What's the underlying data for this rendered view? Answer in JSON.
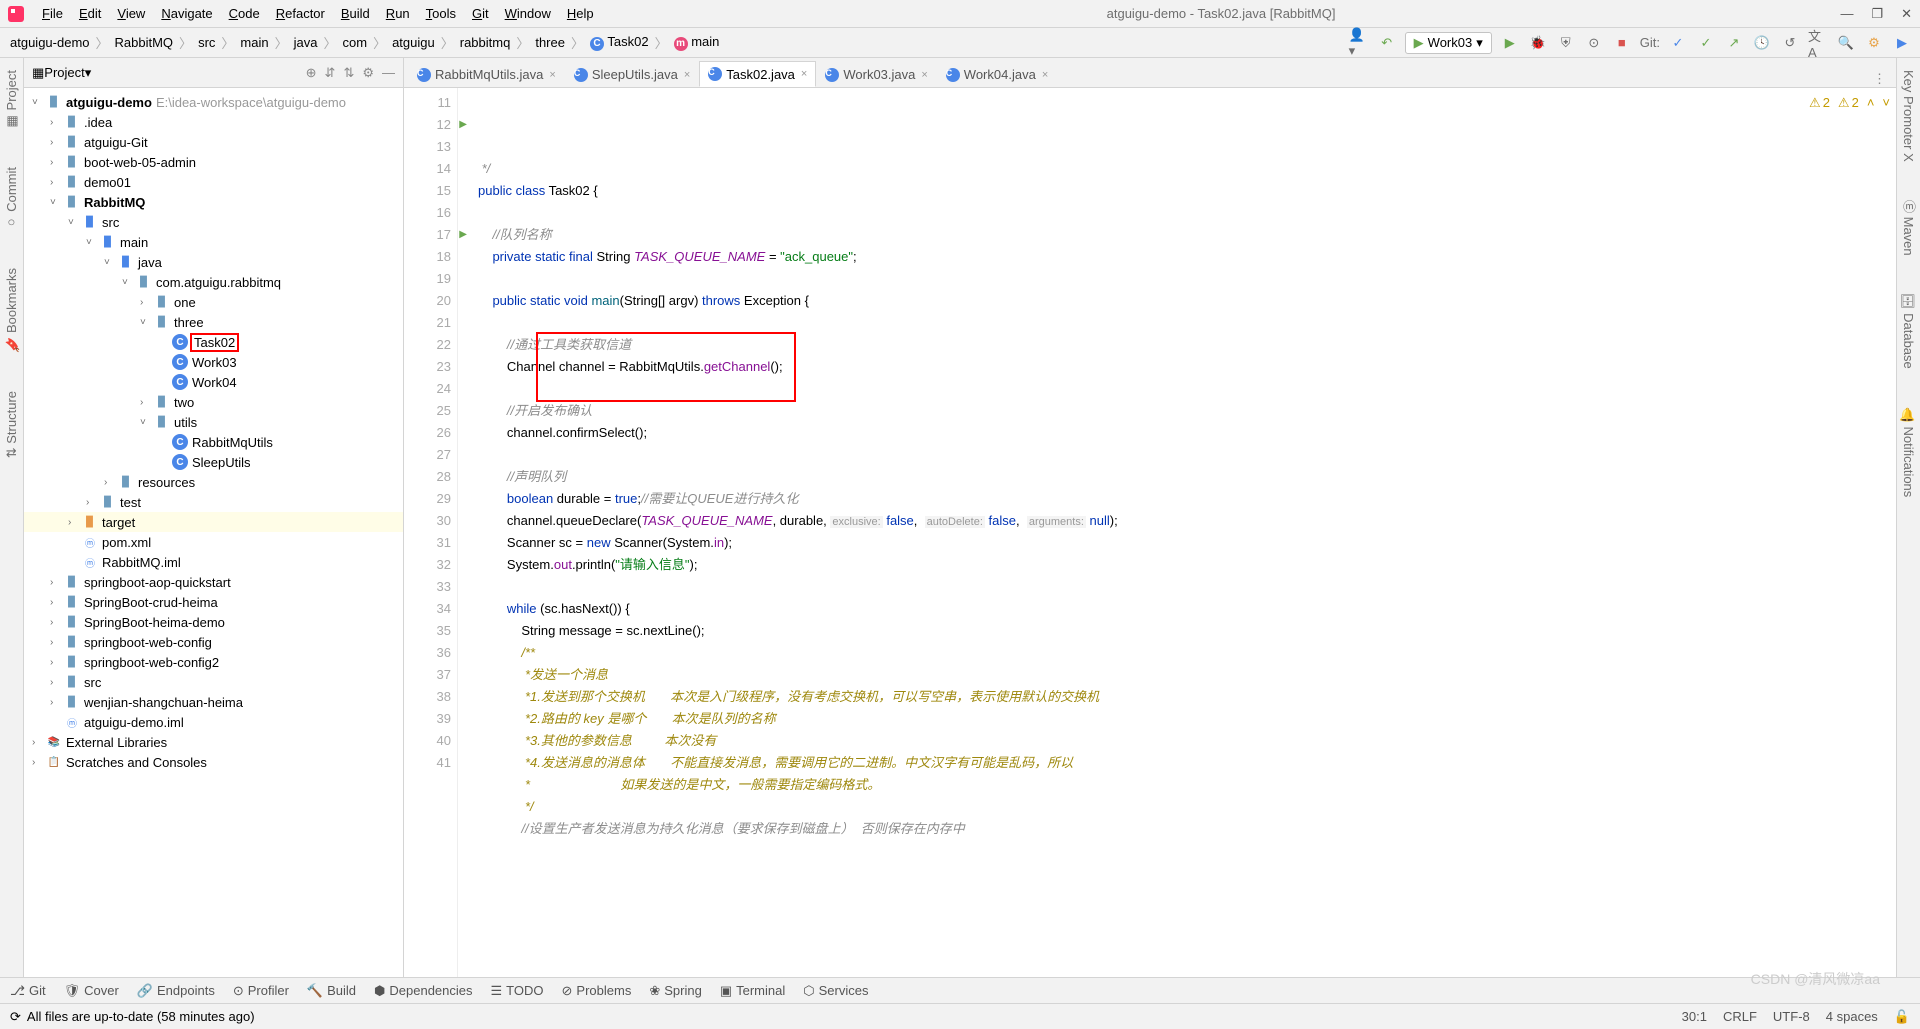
{
  "window": {
    "title": "atguigu-demo - Task02.java [RabbitMQ]"
  },
  "menus": [
    "File",
    "Edit",
    "View",
    "Navigate",
    "Code",
    "Refactor",
    "Build",
    "Run",
    "Tools",
    "Git",
    "Window",
    "Help"
  ],
  "breadcrumb": {
    "parts": [
      "atguigu-demo",
      "RabbitMQ",
      "src",
      "main",
      "java",
      "com",
      "atguigu",
      "rabbitmq",
      "three"
    ],
    "class": "Task02",
    "method": "main"
  },
  "run_config": "Work03",
  "git_label": "Git:",
  "project_panel": {
    "title": "Project",
    "root": {
      "name": "atguigu-demo",
      "path": "E:\\idea-workspace\\atguigu-demo"
    },
    "nodes": [
      {
        "indent": 1,
        "arrow": ">",
        "icon": "folder",
        "name": ".idea"
      },
      {
        "indent": 1,
        "arrow": ">",
        "icon": "folder",
        "name": "atguigu-Git"
      },
      {
        "indent": 1,
        "arrow": ">",
        "icon": "folder",
        "name": "boot-web-05-admin"
      },
      {
        "indent": 1,
        "arrow": ">",
        "icon": "folder",
        "name": "demo01"
      },
      {
        "indent": 1,
        "arrow": "v",
        "icon": "folder",
        "name": "RabbitMQ",
        "bold": true
      },
      {
        "indent": 2,
        "arrow": "v",
        "icon": "folder-blue",
        "name": "src"
      },
      {
        "indent": 3,
        "arrow": "v",
        "icon": "folder-blue",
        "name": "main"
      },
      {
        "indent": 4,
        "arrow": "v",
        "icon": "folder-blue",
        "name": "java"
      },
      {
        "indent": 5,
        "arrow": "v",
        "icon": "folder",
        "name": "com.atguigu.rabbitmq"
      },
      {
        "indent": 6,
        "arrow": ">",
        "icon": "folder",
        "name": "one"
      },
      {
        "indent": 6,
        "arrow": "v",
        "icon": "folder",
        "name": "three"
      },
      {
        "indent": 7,
        "arrow": "",
        "icon": "class",
        "name": "Task02",
        "selected": true
      },
      {
        "indent": 7,
        "arrow": "",
        "icon": "class",
        "name": "Work03"
      },
      {
        "indent": 7,
        "arrow": "",
        "icon": "class",
        "name": "Work04"
      },
      {
        "indent": 6,
        "arrow": ">",
        "icon": "folder",
        "name": "two"
      },
      {
        "indent": 6,
        "arrow": "v",
        "icon": "folder",
        "name": "utils"
      },
      {
        "indent": 7,
        "arrow": "",
        "icon": "class",
        "name": "RabbitMqUtils"
      },
      {
        "indent": 7,
        "arrow": "",
        "icon": "class",
        "name": "SleepUtils"
      },
      {
        "indent": 4,
        "arrow": ">",
        "icon": "folder",
        "name": "resources"
      },
      {
        "indent": 3,
        "arrow": ">",
        "icon": "folder",
        "name": "test"
      },
      {
        "indent": 2,
        "arrow": ">",
        "icon": "folder-orange",
        "name": "target",
        "highlighted": true
      },
      {
        "indent": 2,
        "arrow": "",
        "icon": "module",
        "name": "pom.xml"
      },
      {
        "indent": 2,
        "arrow": "",
        "icon": "module",
        "name": "RabbitMQ.iml"
      },
      {
        "indent": 1,
        "arrow": ">",
        "icon": "folder",
        "name": "springboot-aop-quickstart"
      },
      {
        "indent": 1,
        "arrow": ">",
        "icon": "folder",
        "name": "SpringBoot-crud-heima"
      },
      {
        "indent": 1,
        "arrow": ">",
        "icon": "folder",
        "name": "SpringBoot-heima-demo"
      },
      {
        "indent": 1,
        "arrow": ">",
        "icon": "folder",
        "name": "springboot-web-config"
      },
      {
        "indent": 1,
        "arrow": ">",
        "icon": "folder",
        "name": "springboot-web-config2"
      },
      {
        "indent": 1,
        "arrow": ">",
        "icon": "folder",
        "name": "src"
      },
      {
        "indent": 1,
        "arrow": ">",
        "icon": "folder",
        "name": "wenjian-shangchuan-heima"
      },
      {
        "indent": 1,
        "arrow": "",
        "icon": "module",
        "name": "atguigu-demo.iml"
      },
      {
        "indent": 0,
        "arrow": ">",
        "icon": "lib",
        "name": "External Libraries"
      },
      {
        "indent": 0,
        "arrow": ">",
        "icon": "scratch",
        "name": "Scratches and Consoles"
      }
    ]
  },
  "tabs": [
    {
      "name": "RabbitMqUtils.java",
      "active": false
    },
    {
      "name": "SleepUtils.java",
      "active": false
    },
    {
      "name": "Task02.java",
      "active": true
    },
    {
      "name": "Work03.java",
      "active": false
    },
    {
      "name": "Work04.java",
      "active": false
    }
  ],
  "warnings": {
    "count1": "2",
    "count2": "2"
  },
  "code_lines": [
    {
      "n": 11,
      "html": "<span class='com'> */</span>"
    },
    {
      "n": 12,
      "run": true,
      "html": "<span class='kw'>public class</span> Task02 {"
    },
    {
      "n": 13,
      "html": ""
    },
    {
      "n": 14,
      "html": "    <span class='com'>//队列名称</span>"
    },
    {
      "n": 15,
      "html": "    <span class='kw'>private static final</span> String <span class='const'>TASK_QUEUE_NAME</span> = <span class='str'>\"ack_queue\"</span>;"
    },
    {
      "n": 16,
      "html": ""
    },
    {
      "n": 17,
      "run": true,
      "html": "    <span class='kw'>public static void</span> <span class='method'>main</span>(String[] argv) <span class='kw'>throws</span> Exception {"
    },
    {
      "n": 18,
      "html": ""
    },
    {
      "n": 19,
      "html": "        <span class='com'>//通过工具类获取信道</span>"
    },
    {
      "n": 20,
      "html": "        Channel channel = RabbitMqUtils.<span class='field'>getChannel</span>();"
    },
    {
      "n": 21,
      "html": ""
    },
    {
      "n": 22,
      "html": "        <span class='com'>//开启发布确认</span>"
    },
    {
      "n": 23,
      "html": "        channel.confirmSelect();"
    },
    {
      "n": 24,
      "html": ""
    },
    {
      "n": 25,
      "html": "        <span class='com'>//声明队列</span>"
    },
    {
      "n": 26,
      "html": "        <span class='kw'>boolean</span> durable = <span class='kw'>true</span>;<span class='com'>//需要让QUEUE进行持久化</span>"
    },
    {
      "n": 27,
      "html": "        channel.queueDeclare(<span class='const'>TASK_QUEUE_NAME</span>, durable, <span class='param-hint'>exclusive:</span> <span class='kw'>false</span>,  <span class='param-hint'>autoDelete:</span> <span class='kw'>false</span>,  <span class='param-hint'>arguments:</span> <span class='kw'>null</span>);"
    },
    {
      "n": 28,
      "html": "        Scanner sc = <span class='kw'>new</span> Scanner(System.<span class='field'>in</span>);"
    },
    {
      "n": 29,
      "html": "        System.<span class='field'>out</span>.println(<span class='str'>\"请输入信息\"</span>);"
    },
    {
      "n": 30,
      "html": ""
    },
    {
      "n": 31,
      "html": "        <span class='kw'>while</span> (sc.hasNext()) {"
    },
    {
      "n": 32,
      "html": "            String message = sc.nextLine();"
    },
    {
      "n": 33,
      "html": "            <span class='com-green'>/**</span>"
    },
    {
      "n": 34,
      "html": "             <span class='com-green'>*发送一个消息</span>"
    },
    {
      "n": 35,
      "html": "             <span class='com-green'>*1.发送到那个交换机       本次是入门级程序，没有考虑交换机，可以写空串，表示使用默认的交换机</span>"
    },
    {
      "n": 36,
      "html": "             <span class='com-green'>*2.路由的 key 是哪个       本次是队列的名称</span>"
    },
    {
      "n": 37,
      "html": "             <span class='com-green'>*3.其他的参数信息         本次没有</span>"
    },
    {
      "n": 38,
      "html": "             <span class='com-green'>*4.发送消息的消息体       不能直接发消息，需要调用它的二进制。中文汉字有可能是乱码，所以</span>"
    },
    {
      "n": 39,
      "html": "             <span class='com-green'>*                         如果发送的是中文，一般需要指定编码格式。</span>"
    },
    {
      "n": 40,
      "html": "             <span class='com-green'>*/</span>"
    },
    {
      "n": 41,
      "html": "            <span class='com'>//设置生产者发送消息为持久化消息（要求保存到磁盘上）  否则保存在内存中</span>"
    }
  ],
  "bottom_tools": [
    "Git",
    "Cover",
    "Endpoints",
    "Profiler",
    "Build",
    "Dependencies",
    "TODO",
    "Problems",
    "Spring",
    "Terminal",
    "Services"
  ],
  "status": {
    "message": "All files are up-to-date (58 minutes ago)",
    "pos": "30:1",
    "line_sep": "CRLF",
    "encoding": "UTF-8",
    "spaces": "4 spaces"
  },
  "watermark": "CSDN @清风微凉aa"
}
